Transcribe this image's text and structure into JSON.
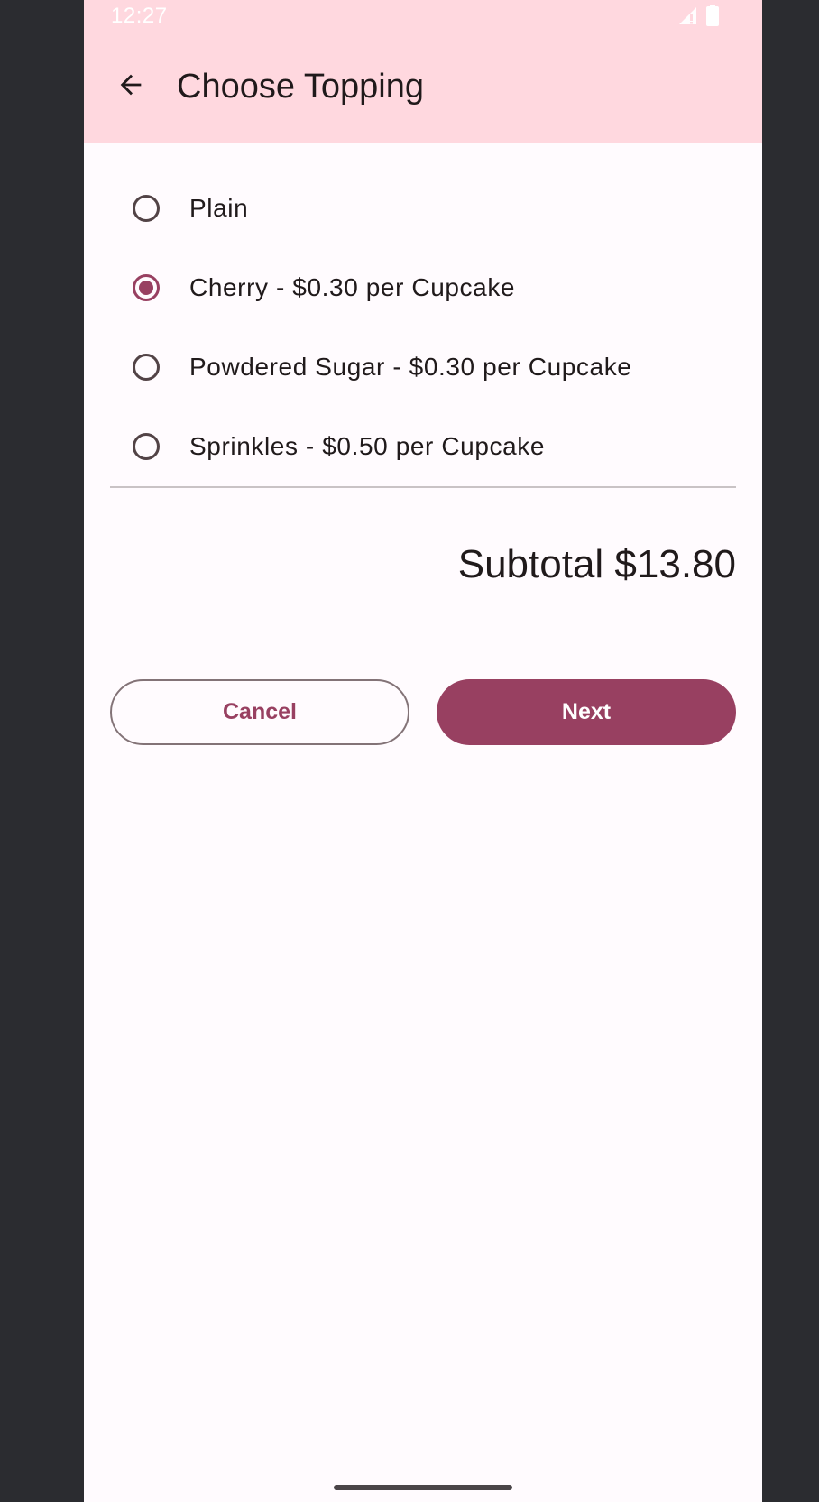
{
  "status_bar": {
    "time": "12:27",
    "icons": [
      "signal-icon",
      "battery-icon"
    ]
  },
  "app_bar": {
    "back_icon": "arrow-back-icon",
    "title": "Choose Topping"
  },
  "options": [
    {
      "label": "Plain",
      "selected": false
    },
    {
      "label": "Cherry - $0.30 per Cupcake",
      "selected": true
    },
    {
      "label": "Powdered Sugar - $0.30 per Cupcake",
      "selected": false
    },
    {
      "label": "Sprinkles - $0.50 per Cupcake",
      "selected": false
    }
  ],
  "subtotal": "Subtotal $13.80",
  "buttons": {
    "cancel_label": "Cancel",
    "next_label": "Next"
  },
  "colors": {
    "app_bar_bg": "#ffd8df",
    "primary": "#984061",
    "background": "#fffbfe",
    "on_surface": "#201a1b"
  }
}
